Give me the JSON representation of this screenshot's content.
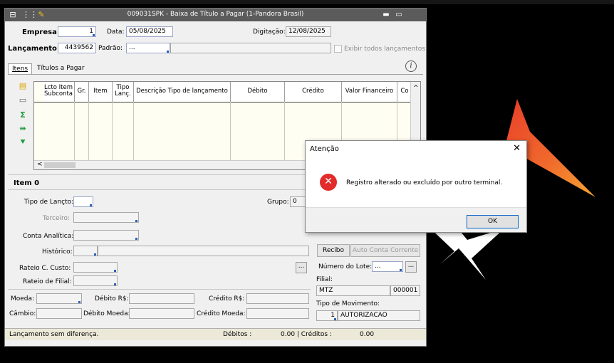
{
  "window": {
    "title": "009031SPK - Baixa de Título a Pagar (1-Pandora Brasil)",
    "minimize_glyph": "▬",
    "maximize_glyph": "▭"
  },
  "header": {
    "empresa_label": "Empresa:",
    "empresa_value": "1",
    "data_label": "Data:",
    "data_value": "05/08/2025",
    "digitacao_label": "Digitação:",
    "digitacao_value": "12/08/2025",
    "lancamento_label": "Lançamento:",
    "lancamento_value": "4439562",
    "padrao_label": "Padrão:",
    "padrao_value": "...",
    "exibir_label": "Exibir todos lançamentos"
  },
  "tabs": [
    {
      "label": "Itens"
    },
    {
      "label": "Títulos a Pagar"
    }
  ],
  "grid": {
    "columns": [
      {
        "label": "Lcto Item Subconta"
      },
      {
        "label": "Gr."
      },
      {
        "label": "Item"
      },
      {
        "label": "Tipo Lanç."
      },
      {
        "label": "Descrição Tipo de lançamento"
      },
      {
        "label": "Débito"
      },
      {
        "label": "Crédito"
      },
      {
        "label": "Valor Financeiro"
      },
      {
        "label": "Co"
      }
    ],
    "scroll_left_glyph": "<",
    "scroll_up_glyph": "^"
  },
  "item": {
    "title": "Item 0",
    "tipo_lancto_label": "Tipo de Lançto:",
    "grupo_label": "Grupo:",
    "grupo_value": "0",
    "terceiro_label": "Terceiro:",
    "conta_label": "Conta Analítica:",
    "historico_label": "Histórico:",
    "rateio_custo_label": "Rateio C. Custo:",
    "rateio_filial_label": "Rateio de Filial:",
    "moeda_label": "Moeda:",
    "debito_rs_label": "Débito R$:",
    "credito_rs_label": "Crédito R$:",
    "cambio_label": "Câmbio:",
    "debito_moeda_label": "Débito Moeda:",
    "credito_moeda_label": "Crédito Moeda:",
    "ellipsis": "..."
  },
  "right_panel": {
    "recibo_label": "Recibo",
    "auto_conta_label": "Auto Conta Corrente",
    "numero_lote_label": "Número do Lote:",
    "numero_lote_value": "...",
    "filial_label": "Filial:",
    "filial_value": "MTZ",
    "filial_code": "000001",
    "tipo_mov_label": "Tipo de Movimento:",
    "tipo_mov_num": "1",
    "tipo_mov_value": "AUTORIZACAO"
  },
  "status": {
    "message": "Lançamento sem diferença.",
    "debitos_label": "Débitos :",
    "debitos_value": "0.00 | Créditos :",
    "creditos_value": "0.00"
  },
  "dialog": {
    "title": "Atenção",
    "close_glyph": "✕",
    "error_glyph": "✕",
    "message": "Registro alterado ou excluído por outro terminal.",
    "ok_label": "OK"
  },
  "colors": {
    "titlebar": "#5b5b5b",
    "grid_bg": "#fffef2",
    "error_red": "#e22b2b",
    "logo_red": "#e8392a",
    "logo_orange": "#f7a531"
  }
}
